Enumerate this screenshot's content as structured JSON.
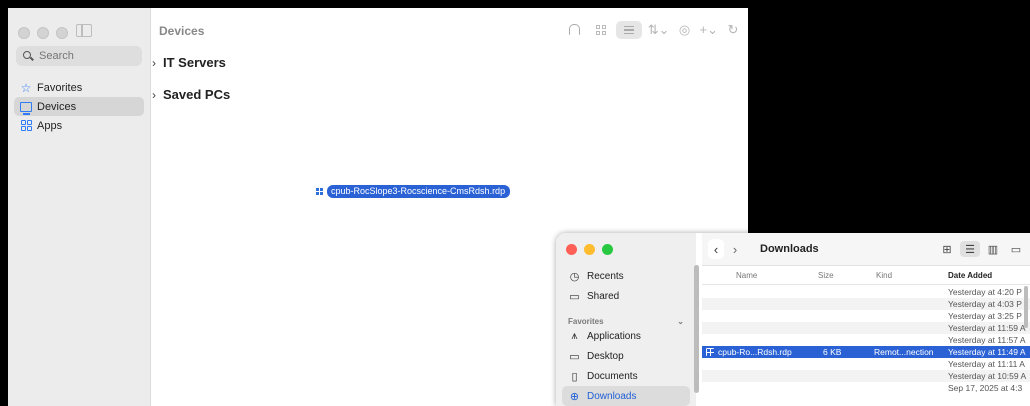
{
  "main_window": {
    "title": "Devices",
    "search_placeholder": "Search",
    "sidebar_items": [
      {
        "label": "Favorites",
        "icon": "star-icon"
      },
      {
        "label": "Devices",
        "icon": "monitor-icon"
      },
      {
        "label": "Apps",
        "icon": "grid-icon"
      }
    ],
    "groups": [
      {
        "label": "IT Servers"
      },
      {
        "label": "Saved PCs"
      }
    ],
    "dragged_file": "cpub-RocSlope3-Rocscience-CmsRdsh.rdp"
  },
  "finder": {
    "title": "Downloads",
    "sidebar_top": [
      {
        "label": "Recents",
        "icon": "clock-icon"
      },
      {
        "label": "Shared",
        "icon": "shared-folder-icon"
      }
    ],
    "favorites_section": "Favorites",
    "sidebar_fav": [
      {
        "label": "Applications",
        "icon": "applications-icon"
      },
      {
        "label": "Desktop",
        "icon": "desktop-icon"
      },
      {
        "label": "Documents",
        "icon": "document-icon"
      },
      {
        "label": "Downloads",
        "icon": "download-icon"
      }
    ],
    "columns": {
      "name": "Name",
      "size": "Size",
      "kind": "Kind",
      "date": "Date Added"
    },
    "rows": [
      {
        "name": "",
        "size": "",
        "kind": "",
        "date": "Yesterday at 4:20 P"
      },
      {
        "name": "",
        "size": "",
        "kind": "",
        "date": "Yesterday at 4:03 P"
      },
      {
        "name": "",
        "size": "",
        "kind": "",
        "date": "Yesterday at 3:25 P"
      },
      {
        "name": "",
        "size": "",
        "kind": "",
        "date": "Yesterday at 11:59 A"
      },
      {
        "name": "",
        "size": "",
        "kind": "",
        "date": "Yesterday at 11:57 A"
      },
      {
        "name": "cpub-Ro...Rdsh.rdp",
        "size": "6 KB",
        "kind": "Remot...nection",
        "date": "Yesterday at 11:49 A"
      },
      {
        "name": "",
        "size": "",
        "kind": "",
        "date": "Yesterday at 11:11 A"
      },
      {
        "name": "",
        "size": "",
        "kind": "",
        "date": "Yesterday at 10:59 A"
      },
      {
        "name": "",
        "size": "",
        "kind": "",
        "date": "Sep 17, 2025 at 4:3"
      }
    ]
  },
  "colors": {
    "accent": "#2a62d6",
    "sidebar_icon": "#2f7cf6"
  }
}
